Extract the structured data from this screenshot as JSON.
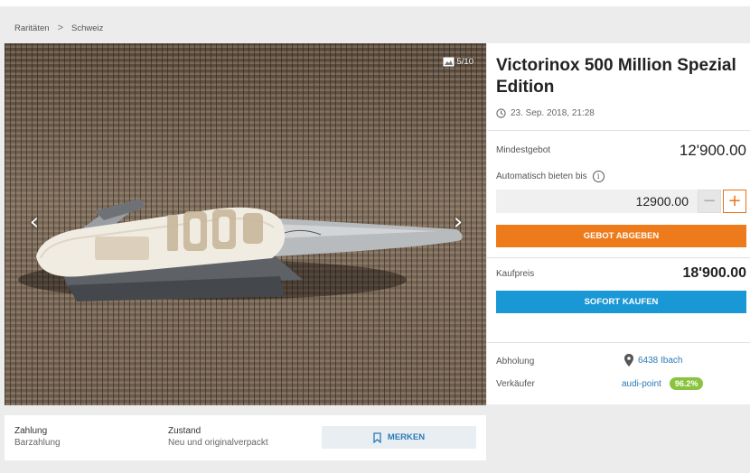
{
  "breadcrumb": {
    "items": [
      "Raritäten",
      "Schweiz"
    ],
    "separator": ">"
  },
  "gallery": {
    "counter": "5/10",
    "prev_icon": "chevron-left-icon",
    "next_icon": "chevron-right-icon"
  },
  "listing": {
    "title": "Victorinox 500 Million Spezial Edition",
    "date": "23. Sep. 2018, 21:28",
    "min_bid_label": "Mindestgebot",
    "min_bid_value": "12'900.00",
    "auto_bid_label": "Automatisch bieten bis",
    "bid_input_value": "12900.00",
    "minus_label": "−",
    "plus_label": "+",
    "bid_button": "Gebot abgeben",
    "buy_price_label": "Kaufpreis",
    "buy_price_value": "18'900.00",
    "buy_button": "Sofort kaufen",
    "pickup_label": "Abholung",
    "pickup_value": "6438 Ibach",
    "seller_label": "Verkäufer",
    "seller_name": "audi-point",
    "seller_rating": "96.2%"
  },
  "bottom": {
    "payment_label": "Zahlung",
    "payment_value": "Barzahlung",
    "condition_label": "Zustand",
    "condition_value": "Neu und originalverpackt",
    "bookmark_label": "Merken"
  },
  "colors": {
    "accent_orange": "#ee7b1b",
    "accent_blue": "#1a98d6",
    "link": "#2a7ab8",
    "badge_green": "#8ac43f"
  }
}
